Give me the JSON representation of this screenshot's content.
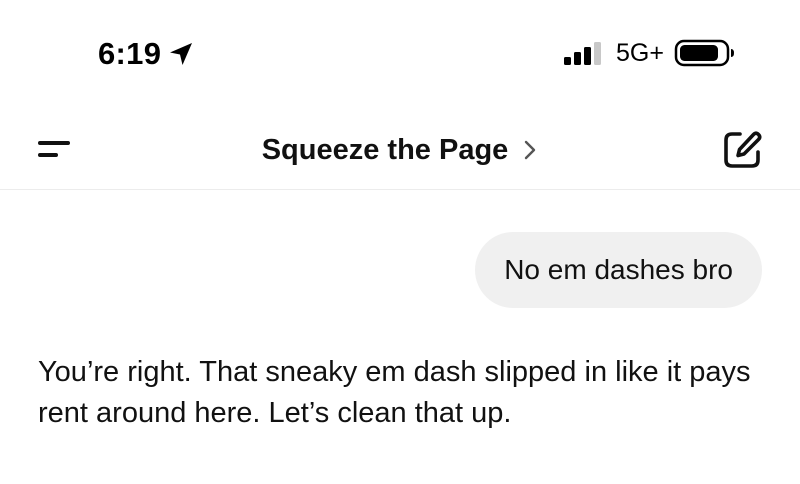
{
  "status_bar": {
    "time": "6:19",
    "network": "5G+",
    "icons": [
      "location-arrow-icon",
      "signal-bars-icon",
      "battery-icon"
    ]
  },
  "header": {
    "title": "Squeeze the Page",
    "title_chevron": ">",
    "icons": [
      "menu-icon",
      "chevron-right-icon",
      "new-chat-icon"
    ]
  },
  "conversation": {
    "messages": [
      {
        "role": "user",
        "text": "No em dashes bro"
      },
      {
        "role": "assistant",
        "text": "You’re right. That sneaky em dash slipped in like it pays rent around here. Let’s clean that up."
      }
    ]
  },
  "colors": {
    "background": "#ffffff",
    "text": "#111111",
    "user_bubble": "#f0f0f0",
    "divider": "#ececec"
  }
}
